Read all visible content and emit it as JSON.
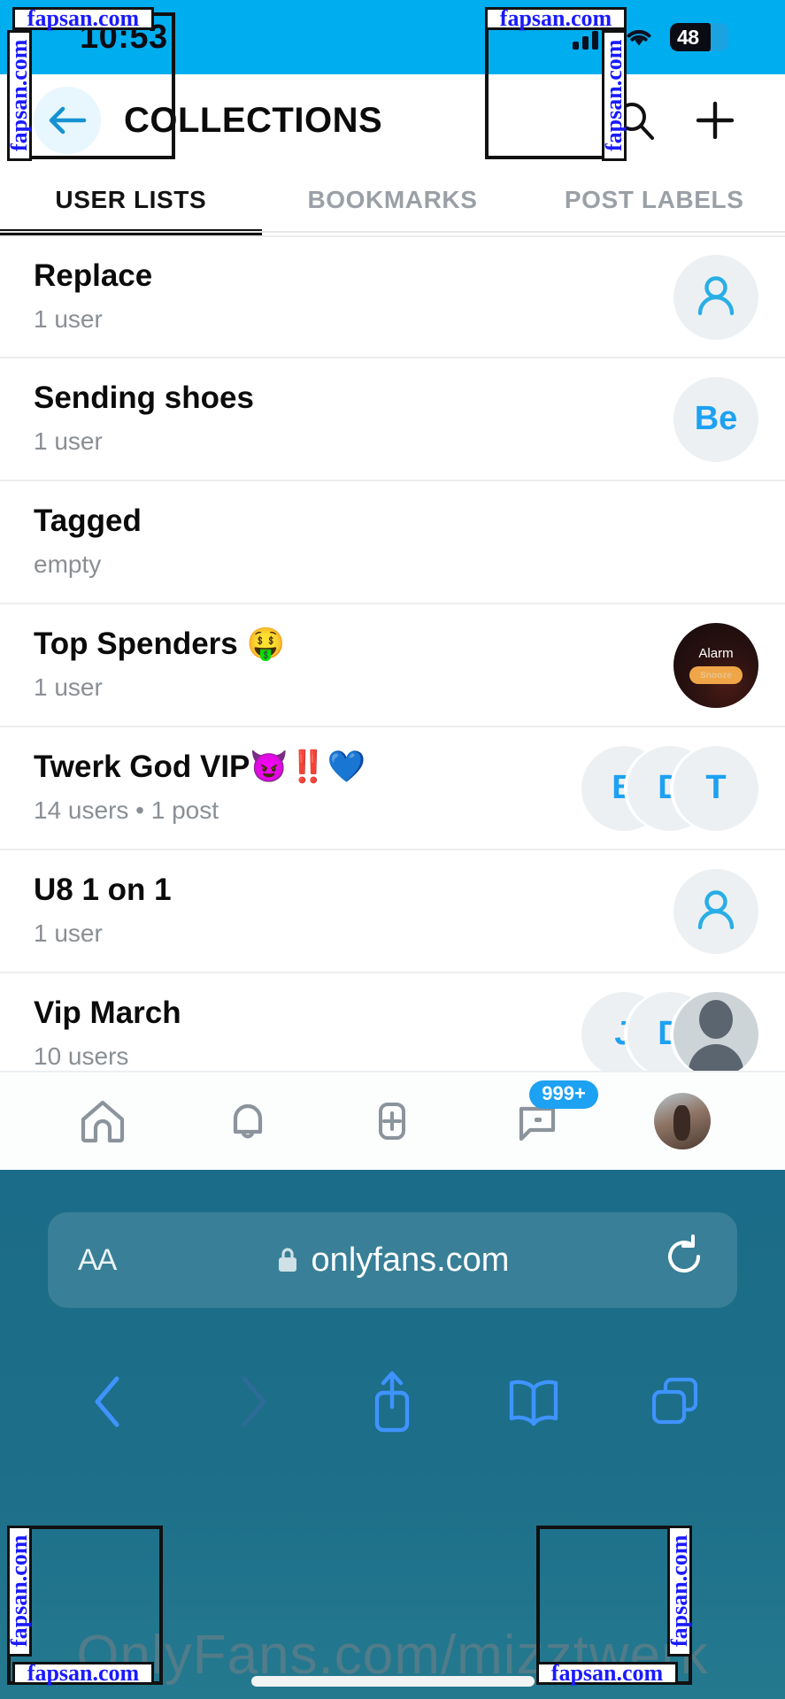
{
  "status_bar": {
    "time": "10:53",
    "battery_level": "48",
    "signal_icon": "cellular-signal-icon",
    "wifi_icon": "wifi-icon",
    "battery_icon": "battery-icon"
  },
  "header": {
    "title": "COLLECTIONS",
    "back_icon": "back-arrow-icon",
    "search_icon": "search-icon",
    "add_icon": "plus-icon"
  },
  "tabs": [
    {
      "label": "USER LISTS",
      "active": true
    },
    {
      "label": "BOOKMARKS",
      "active": false
    },
    {
      "label": "POST LABELS",
      "active": false
    }
  ],
  "lists": [
    {
      "title": "Replace",
      "subtitle": "1 user",
      "avatars": [
        {
          "type": "person-placeholder"
        }
      ]
    },
    {
      "title": "Sending shoes",
      "subtitle": "1 user",
      "avatars": [
        {
          "type": "initials",
          "initials": "Be"
        }
      ]
    },
    {
      "title": "Tagged",
      "subtitle": "empty",
      "avatars": []
    },
    {
      "title": "Top Spenders 🤑",
      "subtitle": "1 user",
      "avatars": [
        {
          "type": "alarm-photo",
          "label": "Alarm",
          "button": "Snooze"
        }
      ]
    },
    {
      "title": "Twerk God VIP😈‼️💙",
      "subtitle": "14 users • 1 post",
      "avatars": [
        {
          "type": "initials",
          "initials": "B"
        },
        {
          "type": "initials",
          "initials": "D"
        },
        {
          "type": "initials",
          "initials": "T"
        }
      ]
    },
    {
      "title": "U8 1 on 1",
      "subtitle": "1 user",
      "avatars": [
        {
          "type": "person-placeholder"
        }
      ]
    },
    {
      "title": "Vip March",
      "subtitle": "10 users",
      "avatars": [
        {
          "type": "initials",
          "initials": "J"
        },
        {
          "type": "initials",
          "initials": "D"
        },
        {
          "type": "person-photo"
        }
      ]
    }
  ],
  "app_nav": [
    {
      "icon": "home-icon",
      "badge": ""
    },
    {
      "icon": "bell-icon",
      "badge": ""
    },
    {
      "icon": "add-post-icon",
      "badge": ""
    },
    {
      "icon": "messages-icon",
      "badge": "999+"
    },
    {
      "icon": "profile-avatar",
      "badge": ""
    }
  ],
  "browser": {
    "text_size_label": "AA",
    "lock_icon": "lock-icon",
    "url": "onlyfans.com",
    "reload_icon": "reload-icon",
    "tools": [
      {
        "icon": "back-chevron-icon"
      },
      {
        "icon": "forward-chevron-icon"
      },
      {
        "icon": "share-icon"
      },
      {
        "icon": "bookmarks-icon"
      },
      {
        "icon": "tabs-icon"
      }
    ],
    "page_watermark": "OnlyFans.com/mizztwerk"
  },
  "watermarks": {
    "text": "fapsan.com"
  },
  "colors": {
    "accent": "#1DA1F2",
    "status_bar": "#00AEEF",
    "browser_chrome": "#1d6e89",
    "badge": "#1DA1F2"
  }
}
